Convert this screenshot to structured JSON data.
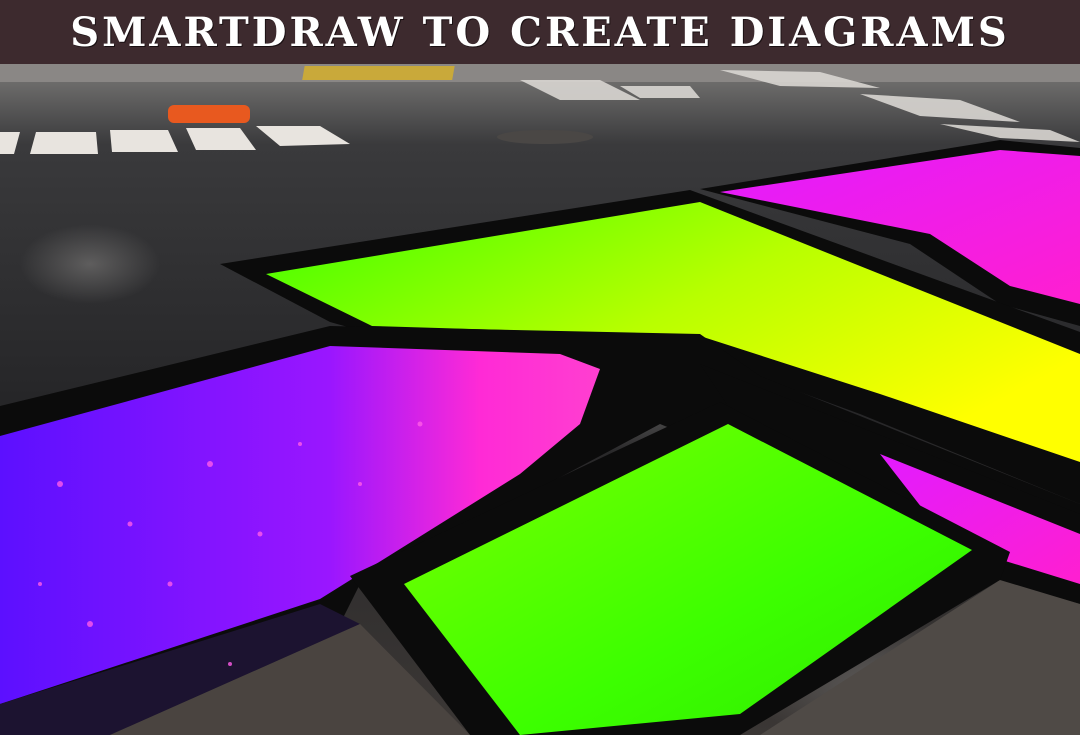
{
  "banner": {
    "title": "SMARTDRAW TO CREATE DIAGRAMS",
    "background_color": "#3d2a2e",
    "text_color": "#ffffff"
  },
  "scene": {
    "subject": "colorful painted shapes on asphalt street",
    "colors": {
      "asphalt": "#2e2e30",
      "outline": "#0b0b0b",
      "neon_green": "#4dff00",
      "yellow": "#f2ff00",
      "magenta": "#ff22dd",
      "purple": "#6a12ff",
      "crosswalk": "#e8e4df"
    }
  }
}
